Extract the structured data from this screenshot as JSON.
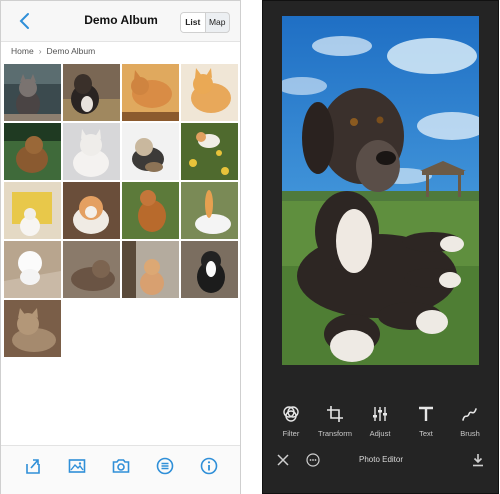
{
  "album": {
    "title": "Demo Album",
    "toggle": {
      "list": "List",
      "map": "Map",
      "selected": "List"
    },
    "breadcrumb": [
      "Home",
      "Demo Album"
    ],
    "tiles": [
      "cat",
      "dog",
      "cat",
      "cat",
      "dog",
      "cat",
      "dog",
      "cat",
      "cat",
      "cat",
      "dog",
      "cat",
      "dog",
      "cat",
      "cat",
      "dog",
      "cat"
    ],
    "tabbar": [
      "share-icon",
      "photo-icon",
      "camera-icon",
      "menu-icon",
      "info-icon"
    ]
  },
  "editor": {
    "tools": [
      {
        "label": "Filter",
        "icon": "filter-icon"
      },
      {
        "label": "Transform",
        "icon": "crop-icon"
      },
      {
        "label": "Adjust",
        "icon": "sliders-icon"
      },
      {
        "label": "Text",
        "icon": "text-icon"
      },
      {
        "label": "Brush",
        "icon": "brush-icon"
      }
    ],
    "title": "Photo Editor"
  },
  "colors": {
    "accent": "#2f8fd8",
    "editor_bg": "#242424"
  }
}
